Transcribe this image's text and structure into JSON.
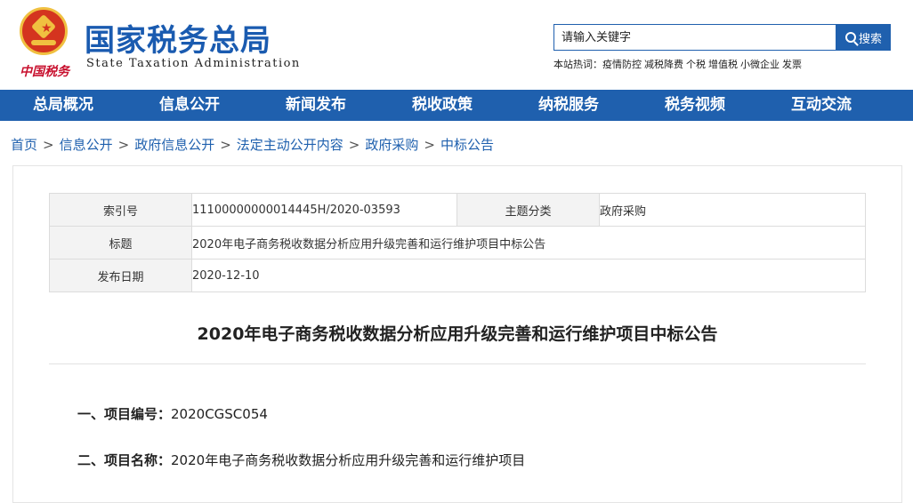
{
  "header": {
    "title": "国家税务总局",
    "subtitle": "State Taxation Administration",
    "seal_text": "中国税务"
  },
  "search": {
    "placeholder": "请输入关键字",
    "button_label": "搜索"
  },
  "hot_words": {
    "label": "本站热词：",
    "items": [
      "疫情防控",
      "减税降费",
      "个税",
      "增值税",
      "小微企业",
      "发票"
    ]
  },
  "nav": [
    "总局概况",
    "信息公开",
    "新闻发布",
    "税收政策",
    "纳税服务",
    "税务视频",
    "互动交流"
  ],
  "breadcrumb": [
    "首页",
    "信息公开",
    "政府信息公开",
    "法定主动公开内容",
    "政府采购",
    "中标公告"
  ],
  "meta": {
    "index_label": "索引号",
    "index_value": "11100000000014445H/2020-03593",
    "topic_label": "主题分类",
    "topic_value": "政府采购",
    "title_label": "标题",
    "title_value": "2020年电子商务税收数据分析应用升级完善和运行维护项目中标公告",
    "date_label": "发布日期",
    "date_value": "2020-12-10"
  },
  "article": {
    "title": "2020年电子商务税收数据分析应用升级完善和运行维护项目中标公告",
    "item1_label": "一、项目编号：",
    "item1_value": "2020CGSC054",
    "item2_label": "二、项目名称：",
    "item2_value": "2020年电子商务税收数据分析应用升级完善和运行维护项目"
  },
  "colors": {
    "brand_blue": "#1f60ae",
    "title_blue": "#1a5bb0",
    "seal_red": "#c8102e"
  }
}
